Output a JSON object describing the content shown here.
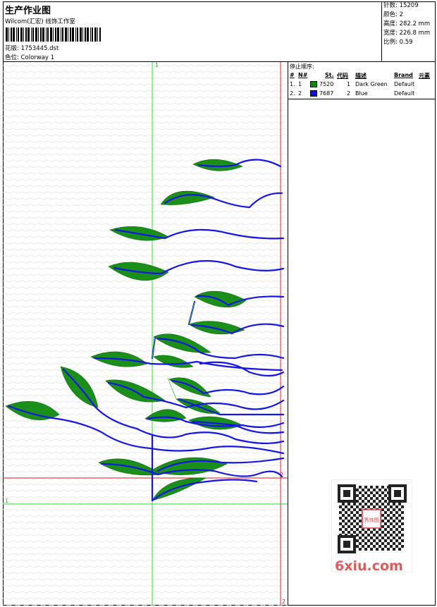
{
  "header": {
    "title": "生产作业图",
    "company": "Wilcom(汇宏) 线饰工作室",
    "design_label": "花版:",
    "design_value": "1753445.dst",
    "colorway_label": "色位:",
    "colorway_value": "Colorway 1"
  },
  "stats": [
    {
      "label": "针数:",
      "value": "15209"
    },
    {
      "label": "颜色:",
      "value": "2"
    },
    {
      "label": "高度:",
      "value": "282.2 mm"
    },
    {
      "label": "宽度:",
      "value": "226.8 mm"
    },
    {
      "label": "比例:",
      "value": "0.59"
    }
  ],
  "stop_sequence": {
    "label": "停止顺序:",
    "columns": [
      "#",
      "N#",
      "St.",
      "代码",
      "描述",
      "Brand",
      "元素"
    ],
    "rows": [
      {
        "idx": "1.",
        "n": "1",
        "code": "7520",
        "st": "1",
        "desc": "Dark Green",
        "brand": "Default",
        "color": "#0a8a0a"
      },
      {
        "idx": "2.",
        "n": "2",
        "code": "7687",
        "st": "2",
        "desc": "Blue",
        "brand": "Default",
        "color": "#1010e0"
      }
    ]
  },
  "guides": {
    "green_label": "1",
    "red_label": "2"
  },
  "colors": {
    "leaf": "#1a8f1a",
    "stem": "#1515e6",
    "guide_green": "#33dd33",
    "guide_red": "#ee2222"
  },
  "watermark": "6xiu.com",
  "qr_label": "秀饰图"
}
